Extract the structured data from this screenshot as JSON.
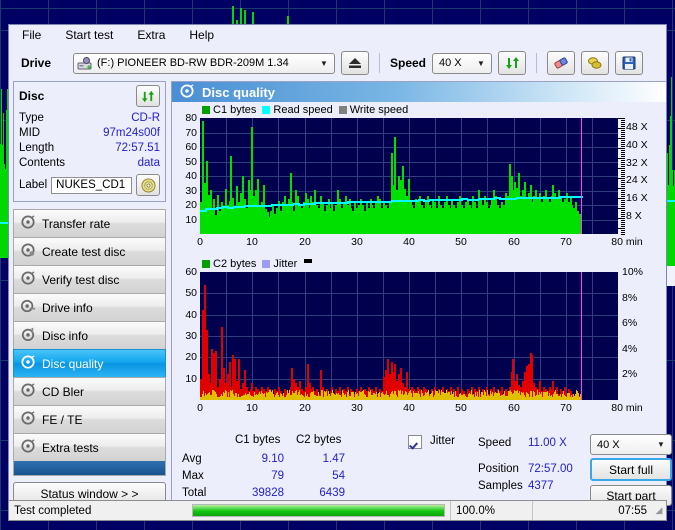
{
  "app": {
    "menu": [
      "File",
      "Start test",
      "Extra",
      "Help"
    ],
    "drive_label": "Drive",
    "drive_value": "(F:)  PIONEER BD-RW  BDR-209M 1.34",
    "speed_label": "Speed",
    "speed_value": "40 X",
    "icons": {
      "drive": "drive-icon",
      "eject": "eject-icon",
      "refresh": "refresh-icon",
      "eraser": "eraser-icon",
      "coins": "coins-icon",
      "save": "save-disk-icon"
    }
  },
  "disc": {
    "title": "Disc",
    "refresh_icon": "refresh-icon",
    "rows": [
      {
        "key": "Type",
        "value": "CD-R"
      },
      {
        "key": "MID",
        "value": "97m24s00f"
      },
      {
        "key": "Length",
        "value": "72:57.51"
      },
      {
        "key": "Contents",
        "value": "data"
      }
    ],
    "label_key": "Label",
    "label_value": "NUKES_CD1",
    "label_icon": "disc-icon"
  },
  "sidebar": {
    "items": [
      {
        "label": "Transfer rate",
        "icon": "disc-transfer-icon",
        "selected": false
      },
      {
        "label": "Create test disc",
        "icon": "disc-create-icon",
        "selected": false
      },
      {
        "label": "Verify test disc",
        "icon": "disc-verify-icon",
        "selected": false
      },
      {
        "label": "Drive info",
        "icon": "drive-info-icon",
        "selected": false
      },
      {
        "label": "Disc info",
        "icon": "disc-info-icon",
        "selected": false
      },
      {
        "label": "Disc quality",
        "icon": "disc-quality-icon",
        "selected": true
      },
      {
        "label": "CD Bler",
        "icon": "disc-bler-icon",
        "selected": false
      },
      {
        "label": "FE / TE",
        "icon": "disc-fete-icon",
        "selected": false
      },
      {
        "label": "Extra tests",
        "icon": "disc-extra-icon",
        "selected": false
      }
    ],
    "status_window_label": "Status window > >"
  },
  "content": {
    "header_title": "Disc quality",
    "header_icon": "disc-quality-icon"
  },
  "chart_data": [
    {
      "type": "area",
      "name": "c1-chart",
      "title": "",
      "xlabel": "min",
      "ylabel": "",
      "xlim": [
        0,
        80
      ],
      "ylim": [
        0,
        80
      ],
      "xticks": [
        0,
        10,
        20,
        30,
        40,
        50,
        60,
        70,
        80
      ],
      "yticks": [
        10,
        20,
        30,
        40,
        50,
        60,
        70,
        80
      ],
      "y2ticks": [
        "8 X",
        "16 X",
        "24 X",
        "32 X",
        "40 X",
        "48 X"
      ],
      "y2lim": [
        0,
        52
      ],
      "grid": true,
      "legend": [
        {
          "label": "C1 bytes",
          "color": "#00a000"
        },
        {
          "label": "Read speed",
          "color": "#00ffff"
        },
        {
          "label": "Write speed",
          "color": "#808080"
        }
      ],
      "data_end_x": 72.96,
      "cursor_x": 73.0,
      "series": [
        {
          "name": "C1 bytes",
          "color": "#00e000",
          "values": [
            22,
            78,
            35,
            50,
            27,
            30,
            18,
            24,
            13,
            27,
            16,
            22,
            18,
            31,
            20,
            23,
            54,
            25,
            19,
            33,
            22,
            28,
            40,
            24,
            18,
            37,
            30,
            74,
            26,
            30,
            38,
            20,
            22,
            34,
            17,
            15,
            12,
            16,
            20,
            14,
            18,
            23,
            16,
            22,
            26,
            20,
            24,
            42,
            22,
            16,
            30,
            26,
            19,
            18,
            22,
            28,
            24,
            18,
            26,
            22,
            30,
            20,
            18,
            26,
            22,
            16,
            20,
            24,
            18,
            22,
            16,
            20,
            30,
            24,
            18,
            22,
            26,
            20,
            24,
            18,
            16,
            22,
            18,
            20,
            24,
            20,
            16,
            22,
            18,
            24,
            20,
            18,
            22,
            26,
            24,
            18,
            22,
            20,
            18,
            22,
            56,
            34,
            67,
            30,
            40,
            37,
            47,
            31,
            26,
            38,
            22,
            20,
            18,
            24,
            22,
            26,
            20,
            18,
            22,
            26,
            20,
            18,
            24,
            22,
            18,
            26,
            20,
            18,
            22,
            26,
            20,
            18,
            24,
            20,
            18,
            22,
            26,
            20,
            18,
            22,
            24,
            20,
            18,
            26,
            22,
            18,
            30,
            24,
            20,
            26,
            22,
            18,
            20,
            24,
            30,
            26,
            20,
            18,
            22,
            20,
            28,
            26,
            48,
            40,
            30,
            36,
            32,
            42,
            26,
            30,
            36,
            24,
            28,
            34,
            22,
            26,
            30,
            24,
            28,
            22,
            26,
            30,
            24,
            22,
            26,
            34,
            28,
            24,
            30,
            26,
            22,
            24,
            28,
            22,
            26,
            20,
            18,
            22,
            16,
            14
          ]
        },
        {
          "name": "Read speed",
          "color": "#00ffff",
          "values_approx": "rises smoothly from ~11X at 0 min to ~17X at 73 min"
        }
      ],
      "write_speed_shown": false
    },
    {
      "type": "area",
      "name": "c2-chart",
      "title": "",
      "xlabel": "min",
      "ylabel": "",
      "xlim": [
        0,
        80
      ],
      "ylim": [
        0,
        60
      ],
      "xticks": [
        0,
        10,
        20,
        30,
        40,
        50,
        60,
        70,
        80
      ],
      "yticks": [
        10,
        20,
        30,
        40,
        50,
        60
      ],
      "y2ticks": [
        "2%",
        "4%",
        "6%",
        "8%",
        "10%"
      ],
      "y2lim": [
        0,
        10
      ],
      "grid": true,
      "legend": [
        {
          "label": "C2 bytes",
          "color": "#00a000"
        },
        {
          "label": "Jitter",
          "color": "#9a9aff"
        }
      ],
      "data_end_x": 72.96,
      "cursor_x": 73.0,
      "series": [
        {
          "name": "C2 bytes",
          "color": "#e00000",
          "values": [
            10,
            42,
            54,
            33,
            12,
            8,
            24,
            22,
            23,
            6,
            10,
            34,
            15,
            8,
            12,
            18,
            6,
            21,
            19,
            9,
            19,
            5,
            8,
            14,
            6,
            4,
            5,
            8,
            4,
            6,
            5,
            4,
            6,
            5,
            4,
            6,
            5,
            4,
            3,
            5,
            4,
            6,
            4,
            3,
            5,
            4,
            3,
            6,
            15,
            10,
            8,
            6,
            9,
            5,
            4,
            6,
            17,
            8,
            5,
            6,
            4,
            5,
            3,
            14,
            6,
            4,
            5,
            3,
            4,
            6,
            3,
            5,
            4,
            6,
            3,
            5,
            4,
            6,
            3,
            5,
            4,
            3,
            5,
            4,
            6,
            3,
            5,
            4,
            6,
            3,
            5,
            4,
            6,
            3,
            5,
            4,
            11,
            14,
            19,
            12,
            18,
            13,
            17,
            9,
            12,
            15,
            8,
            6,
            13,
            5,
            4,
            6,
            5,
            4,
            6,
            5,
            4,
            6,
            5,
            4,
            3,
            5,
            4,
            6,
            3,
            5,
            4,
            6,
            3,
            5,
            4,
            6,
            3,
            5,
            4,
            6,
            3,
            5,
            4,
            3,
            5,
            4,
            6,
            3,
            5,
            4,
            6,
            3,
            5,
            4,
            6,
            3,
            5,
            4,
            6,
            3,
            5,
            4,
            6,
            3,
            5,
            4,
            6,
            13,
            19,
            9,
            12,
            7,
            6,
            9,
            13,
            16,
            17,
            22,
            21,
            8,
            6,
            5,
            9,
            4,
            6,
            5,
            4,
            6,
            5,
            9,
            4,
            6,
            3,
            5,
            4,
            6,
            3,
            5,
            4,
            3,
            2,
            3,
            2,
            2
          ]
        },
        {
          "name": "Jitter",
          "color": "#e0c000",
          "values_approx": "low yellow baseline ~1-3 units across whole disc"
        }
      ]
    }
  ],
  "stats": {
    "col_headers": [
      "C1 bytes",
      "C2 bytes"
    ],
    "rows": [
      {
        "label": "Avg",
        "c1": "9.10",
        "c2": "1.47"
      },
      {
        "label": "Max",
        "c1": "79",
        "c2": "54"
      },
      {
        "label": "Total",
        "c1": "39828",
        "c2": "6439"
      }
    ],
    "jitter_label": "Jitter",
    "jitter_checked": true,
    "right_rows": [
      {
        "label": "Speed",
        "value": "11.00 X"
      },
      {
        "label": "Position",
        "value": "72:57.00"
      },
      {
        "label": "Samples",
        "value": "4377"
      }
    ],
    "speed_select": "40 X",
    "start_full_label": "Start full",
    "start_part_label": "Start part"
  },
  "statusbar": {
    "message": "Test completed",
    "percent": "100.0%",
    "progress": 100,
    "time": "07:55"
  }
}
